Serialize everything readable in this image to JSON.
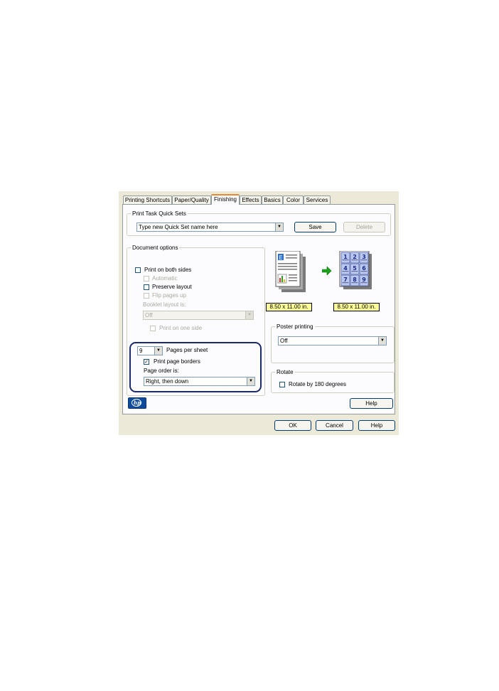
{
  "tabs": [
    {
      "label": "Printing Shortcuts"
    },
    {
      "label": "Paper/Quality"
    },
    {
      "label": "Finishing"
    },
    {
      "label": "Effects"
    },
    {
      "label": "Basics"
    },
    {
      "label": "Color"
    },
    {
      "label": "Services"
    }
  ],
  "active_tab": "Finishing",
  "quick_sets": {
    "legend": "Print Task Quick Sets",
    "value": "Type new Quick Set name here",
    "save_label": "Save",
    "delete_label": "Delete"
  },
  "document_options": {
    "legend": "Document options",
    "print_both_sides": {
      "label": "Print on both sides",
      "checked": false
    },
    "automatic": {
      "label": "Automatic",
      "checked": false,
      "enabled": false
    },
    "preserve_layout": {
      "label": "Preserve layout",
      "checked": false
    },
    "flip_pages_up": {
      "label": "Flip pages up",
      "checked": false,
      "enabled": false
    },
    "booklet_layout_label": "Booklet layout is:",
    "booklet_layout_value": "Off",
    "print_on_one_side": {
      "label": "Print on one side",
      "checked": false,
      "enabled": false
    }
  },
  "pages_per_sheet": {
    "value": "9",
    "label": "Pages per sheet",
    "print_page_borders": {
      "label": "Print page borders",
      "checked": true
    },
    "page_order_label": "Page order is:",
    "page_order_value": "Right, then down"
  },
  "preview": {
    "input_size": "8.50 x 11.00 in.",
    "output_size": "8.50 x 11.00 in.",
    "numbers": [
      "1",
      "2",
      "3",
      "4",
      "5",
      "6",
      "7",
      "8",
      "9"
    ]
  },
  "poster_printing": {
    "legend": "Poster printing",
    "value": "Off"
  },
  "rotate": {
    "legend": "Rotate",
    "label": "Rotate by 180 degrees",
    "checked": false
  },
  "inner_help_label": "Help",
  "footer": {
    "ok_label": "OK",
    "cancel_label": "Cancel",
    "help_label": "Help"
  },
  "colors": {
    "highlight_border": "#1b2a6b",
    "size_label_bg": "#ffff99",
    "arrow_green": "#1aa31a"
  }
}
